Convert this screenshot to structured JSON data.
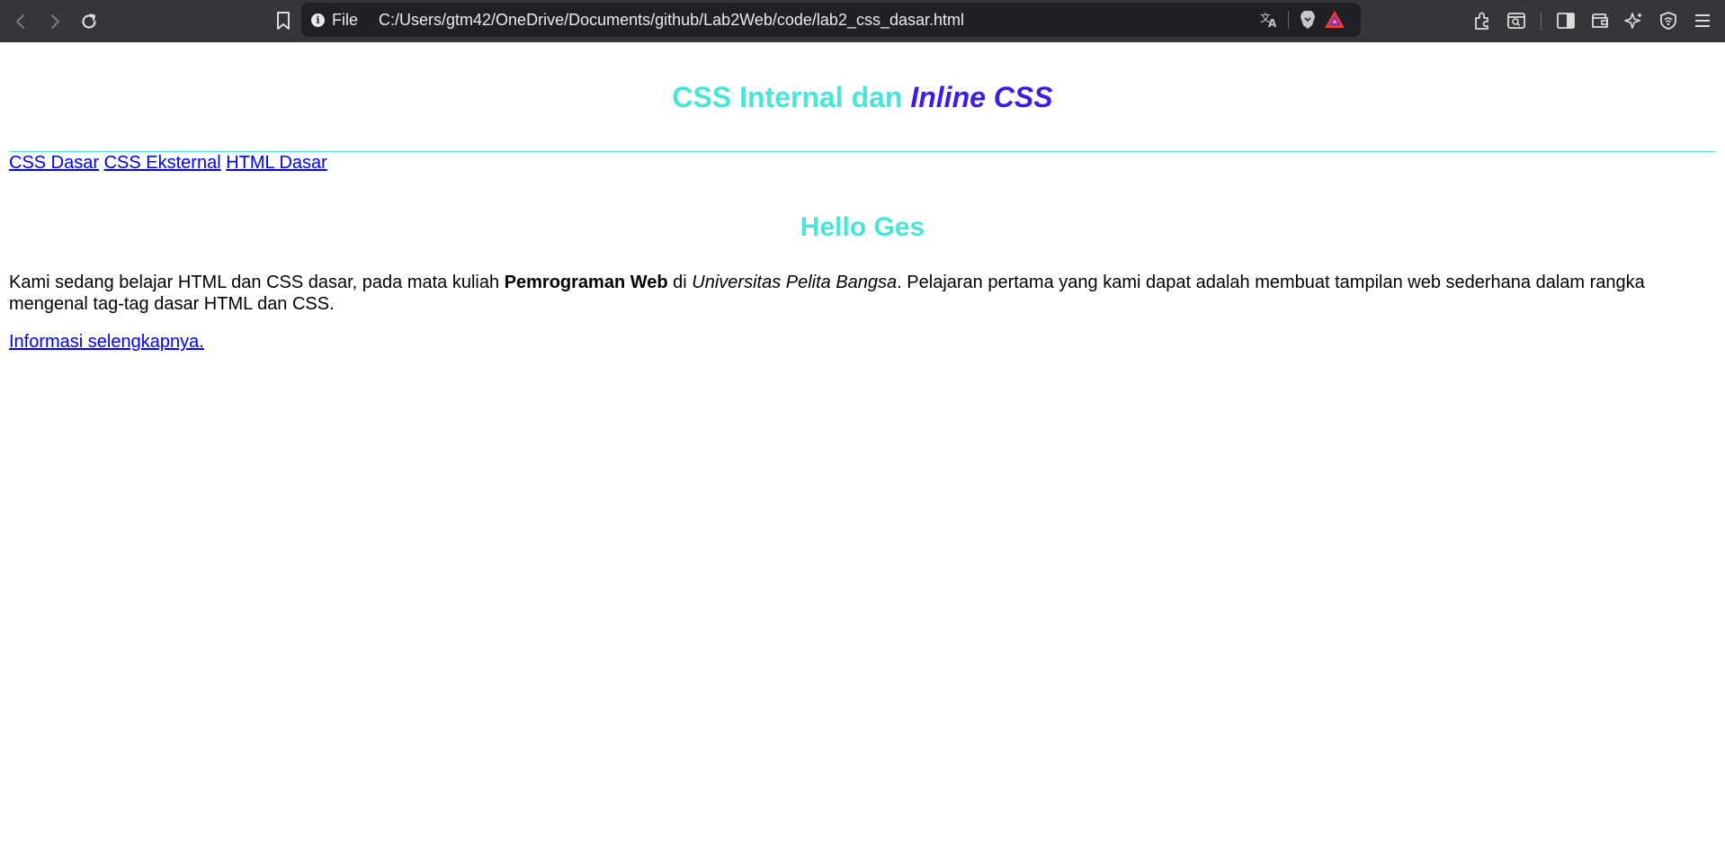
{
  "browser": {
    "site_info_label": "File",
    "url": "C:/Users/gtm42/OneDrive/Documents/github/Lab2Web/code/lab2_css_dasar.html",
    "colors": {
      "toolbar": "#35363a",
      "urlbar": "#202124",
      "icon": "#c7c7c7"
    },
    "icons": [
      "back-icon",
      "forward-icon",
      "reload-icon",
      "bookmark-icon",
      "info-icon",
      "translate-icon",
      "brave-shield-icon",
      "brave-rewards-icon",
      "extensions-icon",
      "search-tab-icon",
      "sidebar-icon",
      "wallet-icon",
      "leo-ai-icon",
      "vpn-icon",
      "menu-icon"
    ]
  },
  "page": {
    "title_part1": "CSS Internal dan ",
    "title_part2": "Inline CSS",
    "nav_links": [
      "CSS Dasar",
      "CSS Eksternal",
      "HTML Dasar"
    ],
    "subtitle": "Hello Ges",
    "paragraph": {
      "text1": "Kami sedang belajar HTML dan CSS dasar, pada mata kuliah ",
      "bold": "Pemrograman Web",
      "text2": " di ",
      "italic": "Universitas Pelita Bangsa",
      "text3": ". Pelajaran pertama yang kami dapat adalah membuat tampilan web sederhana dalam rangka mengenal tag-tag dasar HTML dan CSS."
    },
    "more_link": "Informasi selengkapnya.",
    "colors": {
      "teal": "#48e5d8",
      "purple": "#3b1fe0",
      "link": "#0000ee"
    }
  }
}
